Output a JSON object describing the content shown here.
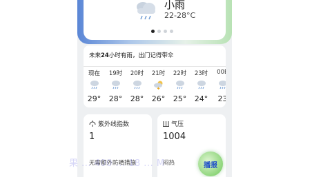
{
  "current": {
    "condition": "小雨",
    "temp_range": "22-28°C",
    "icon": "cloud-rain-icon"
  },
  "pager": {
    "count": 4,
    "active": 0
  },
  "forecast": {
    "tip_prefix": "未来",
    "tip_hours": "24",
    "tip_suffix": "小时有雨，出门记得带伞",
    "hours": [
      {
        "time": "现在",
        "icon": "cloud-rain-icon",
        "temp": "29°"
      },
      {
        "time": "19时",
        "icon": "cloud-rain-icon",
        "temp": "28°"
      },
      {
        "time": "20时",
        "icon": "cloud-rain-icon",
        "temp": "28°"
      },
      {
        "time": "21时",
        "icon": "partly-cloudy-thunder-icon",
        "temp": "26°"
      },
      {
        "time": "22时",
        "icon": "cloud-rain-icon",
        "temp": "25°"
      },
      {
        "time": "23时",
        "icon": "cloud-rain-icon",
        "temp": "24°"
      },
      {
        "time": "00B",
        "icon": "cloud-rain-icon",
        "temp": "23"
      }
    ]
  },
  "uv": {
    "label": "紫外线指数",
    "value": "1",
    "desc": "无需额外防晒措施",
    "icon": "uv-icon"
  },
  "pressure": {
    "label": "气压",
    "value": "1004",
    "desc": "闷热",
    "icon": "pressure-icon"
  },
  "fab": {
    "label": "播报"
  },
  "watermark": "果 ... 400 ... 18 ... M"
}
